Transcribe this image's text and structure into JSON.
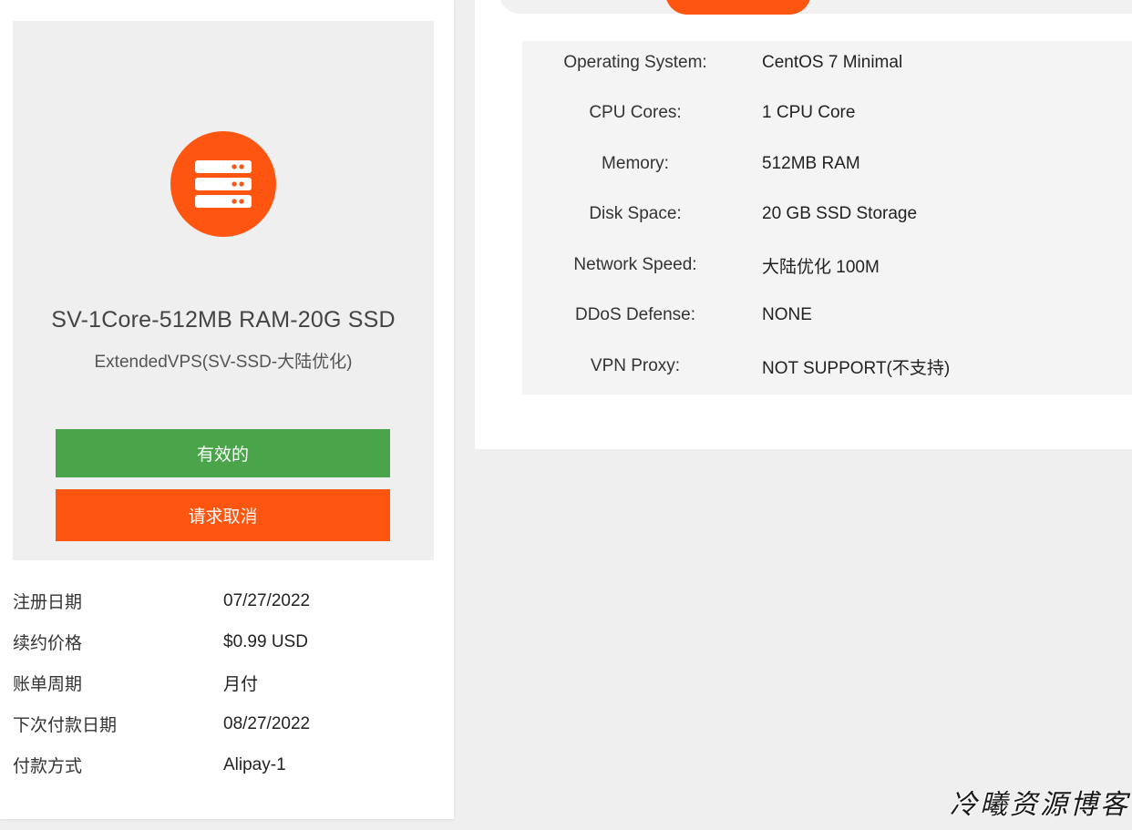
{
  "colors": {
    "accent": "#fe5610",
    "success": "#4aa54a"
  },
  "product": {
    "icon": "server-icon",
    "name": "SV-1Core-512MB RAM-20G SSD",
    "group": "ExtendedVPS(SV-SSD-大陆优化)",
    "status_label": "有效的",
    "cancel_label": "请求取消"
  },
  "info": [
    {
      "label": "注册日期",
      "value": "07/27/2022"
    },
    {
      "label": "续约价格",
      "value": "$0.99 USD"
    },
    {
      "label": "账单周期",
      "value": "月付"
    },
    {
      "label": "下次付款日期",
      "value": "08/27/2022"
    },
    {
      "label": "付款方式",
      "value": "Alipay-1"
    }
  ],
  "specs": [
    {
      "label": "Operating System:",
      "value": "CentOS 7 Minimal"
    },
    {
      "label": "CPU Cores:",
      "value": "1 CPU Core"
    },
    {
      "label": "Memory:",
      "value": "512MB RAM"
    },
    {
      "label": "Disk Space:",
      "value": "20 GB SSD Storage"
    },
    {
      "label": "Network Speed:",
      "value": "大陆优化 100M"
    },
    {
      "label": "DDoS Defense:",
      "value": "NONE"
    },
    {
      "label": "VPN Proxy:",
      "value": "NOT SUPPORT(不支持)"
    }
  ],
  "watermark": "冷曦资源博客"
}
